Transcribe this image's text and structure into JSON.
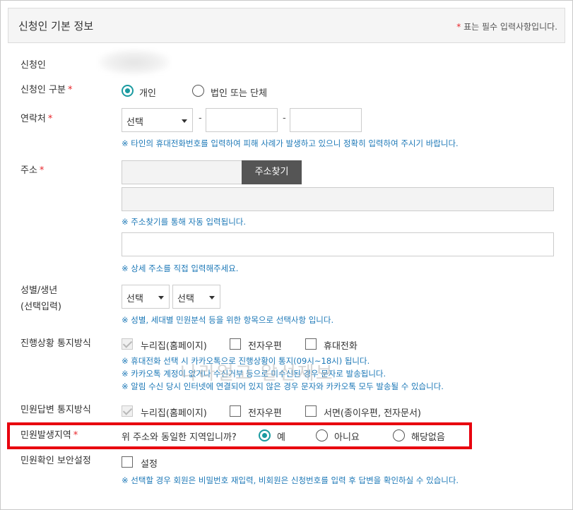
{
  "header": {
    "title": "신청인 기본 정보",
    "note_star": "*",
    "note_text": " 표는 필수 입력사항입니다."
  },
  "req_mark": "*",
  "applicant": {
    "label": "신청인"
  },
  "applicant_type": {
    "label": "신청인 구분",
    "options": [
      "개인",
      "법인 또는 단체"
    ],
    "selected": "개인"
  },
  "contact": {
    "label": "연락처",
    "select_value": "선택",
    "dash": "-",
    "hint": "※ 타인의 휴대전화번호를 입력하여 피해 사례가 발생하고 있으니 정확히 입력하여 주시기 바랍니다."
  },
  "address": {
    "label": "주소",
    "find_button": "주소찾기",
    "hint_auto": "※ 주소찾기를 통해 자동 입력됩니다.",
    "hint_detail": "※ 상세 주소를 직접 입력해주세요."
  },
  "gender_year": {
    "label_line1": "성별/생년",
    "label_line2": "(선택입력)",
    "gender_select": "선택",
    "year_select": "선택",
    "hint": "※ 성별, 세대별 민원분석 등을 위한 항목으로 선택사항 입니다."
  },
  "progress_notice": {
    "label": "진행상황 통지방식",
    "options": [
      "누리집(홈페이지)",
      "전자우편",
      "휴대전화"
    ],
    "hints": [
      "※ 휴대전화 선택 시 카카오톡으로 진행상황이 통지(09시~18시) 됩니다.",
      "※ 카카오톡 계정이 없거나 수신거부 등으로 미수신된 경우 문자로 발송됩니다.",
      "※ 알림 수신 당시 인터넷에 연결되어 있지 않은 경우 문자와 카카오톡 모두 발송될 수 있습니다."
    ],
    "watermark": "나라얼고 알선제보"
  },
  "reply_notice": {
    "label": "민원답변 통지방식",
    "options": [
      "누리집(홈페이지)",
      "전자우편",
      "서면(종이우편, 전자문서)"
    ]
  },
  "complaint_region": {
    "label": "민원발생지역",
    "question": "위 주소와 동일한 지역입니까?",
    "options": [
      "예",
      "아니요",
      "해당없음"
    ],
    "selected": "예",
    "highlight_color": "#e8000e"
  },
  "security": {
    "label": "민원확인 보안설정",
    "option": "설정",
    "hint": "※ 선택할 경우 회원은 비밀번호 재입력, 비회원은 신청번호를 입력 후 답변을 확인하실 수 있습니다."
  },
  "colors": {
    "accent": "#1a9aa0",
    "hint_blue": "#1c78b7",
    "required_red": "#e8252a"
  }
}
